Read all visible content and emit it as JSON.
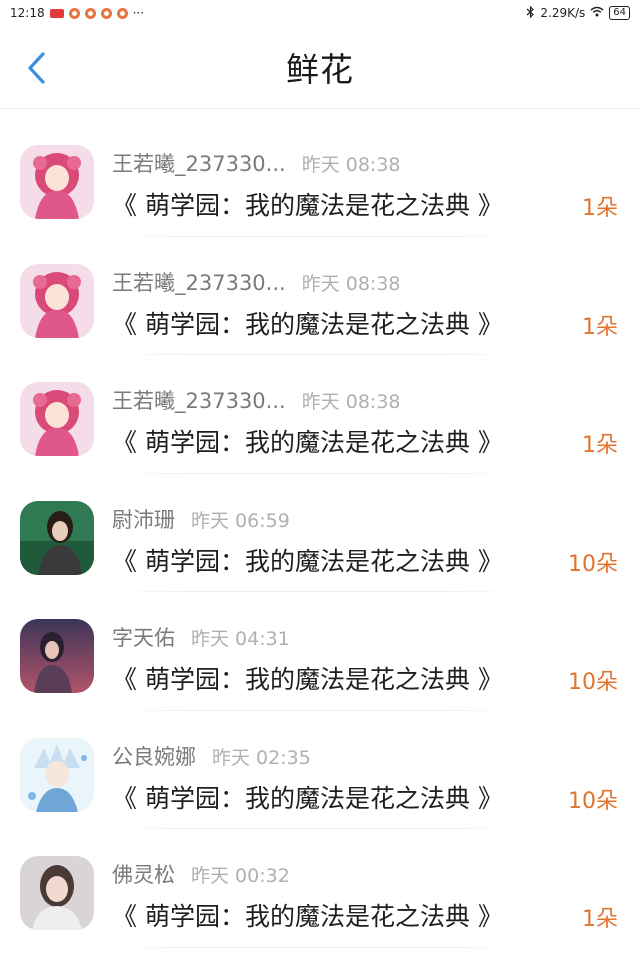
{
  "status_bar": {
    "time": "12:18",
    "more": "···",
    "network_speed": "2.29K/s",
    "battery": "64"
  },
  "header": {
    "title": "鲜花"
  },
  "colors": {
    "accent_blue": "#3b8fe0",
    "flower_count_orange": "#e0742f"
  },
  "items": [
    {
      "username": "王若曦_237330...",
      "time": "昨天 08:38",
      "book": "《 萌学园：我的魔法是花之法典 》",
      "count": "1朵",
      "avatar": "anime-pink-girl"
    },
    {
      "username": "王若曦_237330...",
      "time": "昨天 08:38",
      "book": "《 萌学园：我的魔法是花之法典 》",
      "count": "1朵",
      "avatar": "anime-pink-girl"
    },
    {
      "username": "王若曦_237330...",
      "time": "昨天 08:38",
      "book": "《 萌学园：我的魔法是花之法典 》",
      "count": "1朵",
      "avatar": "anime-pink-girl"
    },
    {
      "username": "尉沛珊",
      "time": "昨天 06:59",
      "book": "《 萌学园：我的魔法是花之法典 》",
      "count": "10朵",
      "avatar": "dark-hair-man"
    },
    {
      "username": "字天佑",
      "time": "昨天 04:31",
      "book": "《 萌学园：我的魔法是花之法典 》",
      "count": "10朵",
      "avatar": "dusk-girl"
    },
    {
      "username": "公良婉娜",
      "time": "昨天 02:35",
      "book": "《 萌学园：我的魔法是花之法典 》",
      "count": "10朵",
      "avatar": "anime-white-hair-boy"
    },
    {
      "username": "佛灵松",
      "time": "昨天 00:32",
      "book": "《 萌学园：我的魔法是花之法典 》",
      "count": "1朵",
      "avatar": "girl-portrait"
    }
  ]
}
